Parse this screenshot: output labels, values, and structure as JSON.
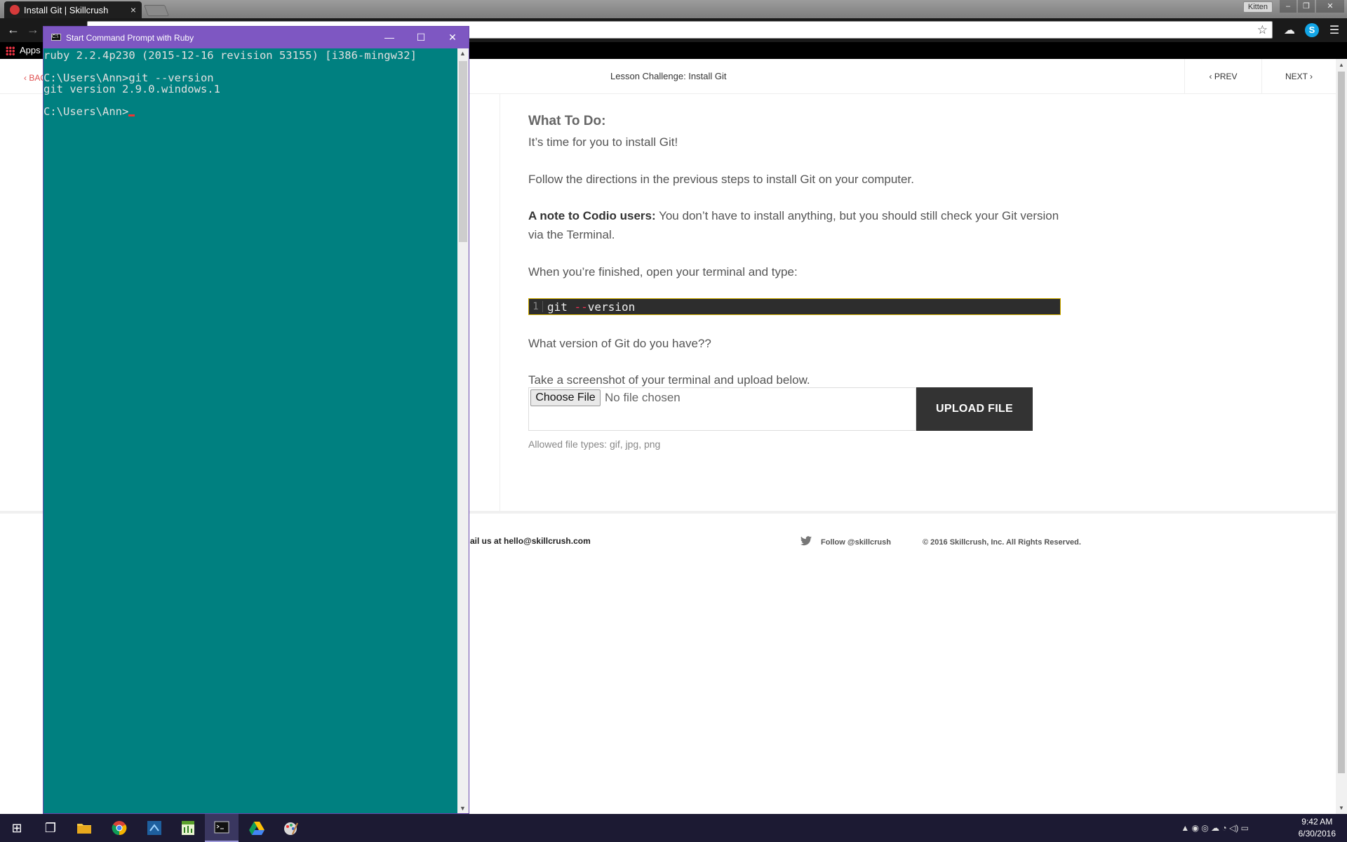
{
  "browser": {
    "tab_title": "Install Git | Skillcrush",
    "tab_close": "×",
    "user_chip": "Kitten",
    "window_controls": [
      "–",
      "❐",
      "✕"
    ],
    "back_glyph": "←",
    "forward_glyph": "→",
    "star_glyph": "☆",
    "menu_glyph": "☰",
    "skype_glyph": "S",
    "drive_glyph": "☁",
    "bookmarks": {
      "apps_label": "Apps"
    }
  },
  "lesson": {
    "back_label": "‹ BAC",
    "title": "Lesson Challenge: Install Git",
    "prev_label": "‹  PREV",
    "next_label": "NEXT  ›"
  },
  "content": {
    "heading": "What To Do:",
    "intro": "It’s time for you to install Git!",
    "directions": "Follow the directions in the previous steps to install Git on your computer.",
    "codio_bold": "A note to Codio users:",
    "codio_text": " You don’t have to install anything, but you should still check your Git version via the Terminal.",
    "finished": "When you’re finished, open your terminal and type:",
    "code": {
      "line_number": "1",
      "cmd": "git ",
      "dashes": "--",
      "arg": "version"
    },
    "question": "What version of Git do you have??",
    "screenshot": "Take a screenshot of your terminal and upload below.",
    "choose_file": "Choose File",
    "no_file": "No file chosen",
    "upload": "UPLOAD FILE",
    "allowed": "Allowed file types: gif, jpg, png"
  },
  "footer": {
    "email": "ail us at hello@skillcrush.com",
    "follow": "Follow @skillcrush",
    "copyright": "© 2016 Skillcrush, Inc. All Rights Reserved."
  },
  "cmd": {
    "title": "Start Command Prompt with Ruby",
    "icon_text": "C:\\",
    "controls": [
      "—",
      "☐",
      "✕"
    ],
    "line1": "ruby 2.2.4p230 (2015-12-16 revision 53155) [i386-mingw32]",
    "line2": "C:\\Users\\Ann>git --version",
    "line3": "git version 2.9.0.windows.1",
    "line4": "C:\\Users\\Ann>"
  },
  "taskbar": {
    "start_glyph": "⊞",
    "taskview_glyph": "❐",
    "tray_glyphs": "▲  ◉  ◎  ☁  ◔  ◁)  ▭",
    "time": "9:42 AM",
    "date": "6/30/2016"
  },
  "colors": {
    "cmd_background": "#008080",
    "cmd_titlebar": "#7e57c2",
    "accent_red": "#e05050",
    "upload_button": "#333333"
  }
}
